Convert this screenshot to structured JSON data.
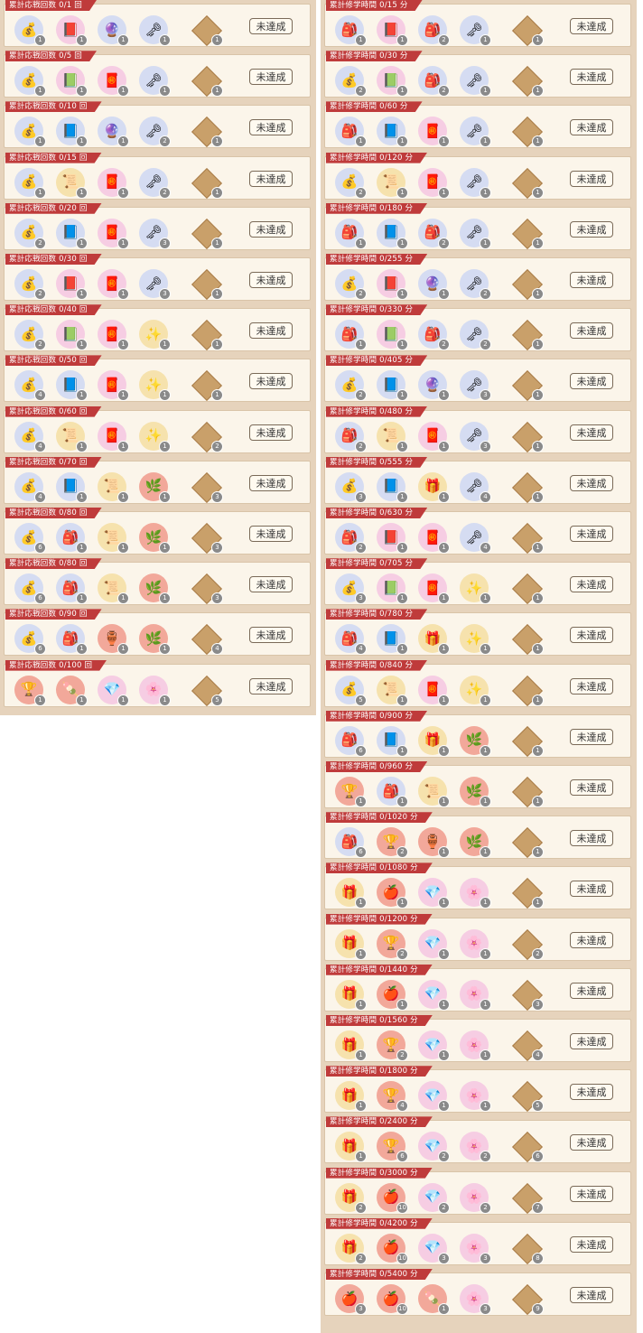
{
  "status_label": "未達成",
  "left_prefix": "累計応戦回数",
  "right_prefix": "累計修学時間",
  "icons": {
    "gold": {
      "glyph": "💰",
      "bg": "bg-bluel"
    },
    "book": {
      "glyph": "📕",
      "bg": "bg-pink"
    },
    "bluebook": {
      "glyph": "📘",
      "bg": "bg-bluel"
    },
    "greenbook": {
      "glyph": "📗",
      "bg": "bg-pink"
    },
    "scroll": {
      "glyph": "📜",
      "bg": "bg-gold"
    },
    "charm": {
      "glyph": "🧧",
      "bg": "bg-pink"
    },
    "talisman": {
      "glyph": "🔮",
      "bg": "bg-bluel"
    },
    "stick": {
      "glyph": "🗝",
      "bg": "bg-bluel"
    },
    "wand": {
      "glyph": "✨",
      "bg": "bg-gold"
    },
    "herb": {
      "glyph": "🌿",
      "bg": "bg-red"
    },
    "bag": {
      "glyph": "🎒",
      "bg": "bg-bluel"
    },
    "chest": {
      "glyph": "🎁",
      "bg": "bg-gold"
    },
    "ingot": {
      "glyph": "🏆",
      "bg": "bg-red"
    },
    "crystal": {
      "glyph": "💎",
      "bg": "bg-pink"
    },
    "petal": {
      "glyph": "🌸",
      "bg": "bg-pink"
    },
    "fruit": {
      "glyph": "🍎",
      "bg": "bg-red"
    },
    "dango": {
      "glyph": "🍡",
      "bg": "bg-red"
    },
    "bottle": {
      "glyph": "🏺",
      "bg": "bg-red"
    }
  },
  "left": [
    {
      "label": "累計応戦回数 0/1 回",
      "items": [
        [
          "gold",
          "1"
        ],
        [
          "book",
          "1"
        ],
        [
          "talisman",
          "1"
        ],
        [
          "stick",
          "1"
        ]
      ],
      "gem": "1"
    },
    {
      "label": "累計応戦回数 0/5 回",
      "items": [
        [
          "gold",
          "1"
        ],
        [
          "greenbook",
          "1"
        ],
        [
          "charm",
          "1"
        ],
        [
          "stick",
          "1"
        ]
      ],
      "gem": "1"
    },
    {
      "label": "累計応戦回数 0/10 回",
      "items": [
        [
          "gold",
          "1"
        ],
        [
          "bluebook",
          "1"
        ],
        [
          "talisman",
          "1"
        ],
        [
          "stick",
          "2"
        ]
      ],
      "gem": "1"
    },
    {
      "label": "累計応戦回数 0/15 回",
      "items": [
        [
          "gold",
          "1"
        ],
        [
          "scroll",
          "1"
        ],
        [
          "charm",
          "1"
        ],
        [
          "stick",
          "2"
        ]
      ],
      "gem": "1"
    },
    {
      "label": "累計応戦回数 0/20 回",
      "items": [
        [
          "gold",
          "2"
        ],
        [
          "bluebook",
          "1"
        ],
        [
          "charm",
          "1"
        ],
        [
          "stick",
          "3"
        ]
      ],
      "gem": "1"
    },
    {
      "label": "累計応戦回数 0/30 回",
      "items": [
        [
          "gold",
          "2"
        ],
        [
          "book",
          "1"
        ],
        [
          "charm",
          "1"
        ],
        [
          "stick",
          "3"
        ]
      ],
      "gem": "1"
    },
    {
      "label": "累計応戦回数 0/40 回",
      "items": [
        [
          "gold",
          "2"
        ],
        [
          "greenbook",
          "1"
        ],
        [
          "charm",
          "1"
        ],
        [
          "wand",
          "1"
        ]
      ],
      "gem": "1"
    },
    {
      "label": "累計応戦回数 0/50 回",
      "items": [
        [
          "gold",
          "4"
        ],
        [
          "bluebook",
          "1"
        ],
        [
          "charm",
          "1"
        ],
        [
          "wand",
          "1"
        ]
      ],
      "gem": "1"
    },
    {
      "label": "累計応戦回数 0/60 回",
      "items": [
        [
          "gold",
          "4"
        ],
        [
          "scroll",
          "1"
        ],
        [
          "charm",
          "1"
        ],
        [
          "wand",
          "1"
        ]
      ],
      "gem": "2"
    },
    {
      "label": "累計応戦回数 0/70 回",
      "items": [
        [
          "gold",
          "4"
        ],
        [
          "bluebook",
          "1"
        ],
        [
          "scroll",
          "1"
        ],
        [
          "herb",
          "1"
        ]
      ],
      "gem": "3"
    },
    {
      "label": "累計応戦回数 0/80 回",
      "items": [
        [
          "gold",
          "6"
        ],
        [
          "bag",
          "1"
        ],
        [
          "scroll",
          "1"
        ],
        [
          "herb",
          "1"
        ]
      ],
      "gem": "3"
    },
    {
      "label": "累計応戦回数 0/80 回",
      "items": [
        [
          "gold",
          "6"
        ],
        [
          "bag",
          "1"
        ],
        [
          "scroll",
          "1"
        ],
        [
          "herb",
          "1"
        ]
      ],
      "gem": "3"
    },
    {
      "label": "累計応戦回数 0/90 回",
      "items": [
        [
          "gold",
          "6"
        ],
        [
          "bag",
          "1"
        ],
        [
          "bottle",
          "1"
        ],
        [
          "herb",
          "1"
        ]
      ],
      "gem": "4"
    },
    {
      "label": "累計応戦回数 0/100 回",
      "items": [
        [
          "ingot",
          "1"
        ],
        [
          "dango",
          "1"
        ],
        [
          "crystal",
          "1"
        ],
        [
          "petal",
          "1"
        ]
      ],
      "gem": "5"
    }
  ],
  "right": [
    {
      "label": "累計修学時間 0/15 分",
      "items": [
        [
          "bag",
          "1"
        ],
        [
          "book",
          "1"
        ],
        [
          "bag",
          "2"
        ],
        [
          "stick",
          "1"
        ]
      ],
      "gem": "1"
    },
    {
      "label": "累計修学時間 0/30 分",
      "items": [
        [
          "gold",
          "2"
        ],
        [
          "greenbook",
          "1"
        ],
        [
          "bag",
          "2"
        ],
        [
          "stick",
          "1"
        ]
      ],
      "gem": "1"
    },
    {
      "label": "累計修学時間 0/60 分",
      "items": [
        [
          "bag",
          "1"
        ],
        [
          "bluebook",
          "1"
        ],
        [
          "charm",
          "1"
        ],
        [
          "stick",
          "1"
        ]
      ],
      "gem": "1"
    },
    {
      "label": "累計修学時間 0/120 分",
      "items": [
        [
          "gold",
          "2"
        ],
        [
          "scroll",
          "1"
        ],
        [
          "charm",
          "1"
        ],
        [
          "stick",
          "1"
        ]
      ],
      "gem": "1"
    },
    {
      "label": "累計修学時間 0/180 分",
      "items": [
        [
          "bag",
          "1"
        ],
        [
          "bluebook",
          "1"
        ],
        [
          "bag",
          "2"
        ],
        [
          "stick",
          "1"
        ]
      ],
      "gem": "1"
    },
    {
      "label": "累計修学時間 0/255 分",
      "items": [
        [
          "gold",
          "2"
        ],
        [
          "book",
          "1"
        ],
        [
          "talisman",
          "1"
        ],
        [
          "stick",
          "2"
        ]
      ],
      "gem": "1"
    },
    {
      "label": "累計修学時間 0/330 分",
      "items": [
        [
          "bag",
          "1"
        ],
        [
          "greenbook",
          "1"
        ],
        [
          "bag",
          "2"
        ],
        [
          "stick",
          "2"
        ]
      ],
      "gem": "1"
    },
    {
      "label": "累計修学時間 0/405 分",
      "items": [
        [
          "gold",
          "2"
        ],
        [
          "bluebook",
          "1"
        ],
        [
          "talisman",
          "1"
        ],
        [
          "stick",
          "3"
        ]
      ],
      "gem": "1"
    },
    {
      "label": "累計修学時間 0/480 分",
      "items": [
        [
          "bag",
          "2"
        ],
        [
          "scroll",
          "1"
        ],
        [
          "charm",
          "1"
        ],
        [
          "stick",
          "3"
        ]
      ],
      "gem": "1"
    },
    {
      "label": "累計修学時間 0/555 分",
      "items": [
        [
          "gold",
          "3"
        ],
        [
          "bluebook",
          "1"
        ],
        [
          "chest",
          "1"
        ],
        [
          "stick",
          "4"
        ]
      ],
      "gem": "1"
    },
    {
      "label": "累計修学時間 0/630 分",
      "items": [
        [
          "bag",
          "2"
        ],
        [
          "book",
          "1"
        ],
        [
          "charm",
          "1"
        ],
        [
          "stick",
          "4"
        ]
      ],
      "gem": "1"
    },
    {
      "label": "累計修学時間 0/705 分",
      "items": [
        [
          "gold",
          "3"
        ],
        [
          "greenbook",
          "1"
        ],
        [
          "charm",
          "1"
        ],
        [
          "wand",
          "1"
        ]
      ],
      "gem": "1"
    },
    {
      "label": "累計修学時間 0/780 分",
      "items": [
        [
          "bag",
          "4"
        ],
        [
          "bluebook",
          "1"
        ],
        [
          "chest",
          "1"
        ],
        [
          "wand",
          "1"
        ]
      ],
      "gem": "1"
    },
    {
      "label": "累計修学時間 0/840 分",
      "items": [
        [
          "gold",
          "5"
        ],
        [
          "scroll",
          "1"
        ],
        [
          "charm",
          "1"
        ],
        [
          "wand",
          "1"
        ]
      ],
      "gem": "1"
    },
    {
      "label": "累計修学時間 0/900 分",
      "items": [
        [
          "bag",
          "6"
        ],
        [
          "bluebook",
          "1"
        ],
        [
          "chest",
          "1"
        ],
        [
          "herb",
          "1"
        ]
      ],
      "gem": "1"
    },
    {
      "label": "累計修学時間 0/960 分",
      "items": [
        [
          "ingot",
          "1"
        ],
        [
          "bag",
          "1"
        ],
        [
          "scroll",
          "1"
        ],
        [
          "herb",
          "1"
        ]
      ],
      "gem": "1"
    },
    {
      "label": "累計修学時間 0/1020 分",
      "items": [
        [
          "bag",
          "6"
        ],
        [
          "ingot",
          "2"
        ],
        [
          "bottle",
          "1"
        ],
        [
          "herb",
          "1"
        ]
      ],
      "gem": "1"
    },
    {
      "label": "累計修学時間 0/1080 分",
      "items": [
        [
          "chest",
          "1"
        ],
        [
          "fruit",
          "1"
        ],
        [
          "crystal",
          "1"
        ],
        [
          "petal",
          "1"
        ]
      ],
      "gem": "1"
    },
    {
      "label": "累計修学時間 0/1200 分",
      "items": [
        [
          "chest",
          "1"
        ],
        [
          "ingot",
          "2"
        ],
        [
          "crystal",
          "1"
        ],
        [
          "petal",
          "1"
        ]
      ],
      "gem": "2"
    },
    {
      "label": "累計修学時間 0/1440 分",
      "items": [
        [
          "chest",
          "1"
        ],
        [
          "fruit",
          "1"
        ],
        [
          "crystal",
          "1"
        ],
        [
          "petal",
          "1"
        ]
      ],
      "gem": "3"
    },
    {
      "label": "累計修学時間 0/1560 分",
      "items": [
        [
          "chest",
          "1"
        ],
        [
          "ingot",
          "2"
        ],
        [
          "crystal",
          "1"
        ],
        [
          "petal",
          "1"
        ]
      ],
      "gem": "4"
    },
    {
      "label": "累計修学時間 0/1800 分",
      "items": [
        [
          "chest",
          "1"
        ],
        [
          "ingot",
          "4"
        ],
        [
          "crystal",
          "1"
        ],
        [
          "petal",
          "1"
        ]
      ],
      "gem": "5"
    },
    {
      "label": "累計修学時間 0/2400 分",
      "items": [
        [
          "chest",
          "1"
        ],
        [
          "ingot",
          "6"
        ],
        [
          "crystal",
          "2"
        ],
        [
          "petal",
          "2"
        ]
      ],
      "gem": "6"
    },
    {
      "label": "累計修学時間 0/3000 分",
      "items": [
        [
          "chest",
          "2"
        ],
        [
          "fruit",
          "10"
        ],
        [
          "crystal",
          "2"
        ],
        [
          "petal",
          "2"
        ]
      ],
      "gem": "7"
    },
    {
      "label": "累計修学時間 0/4200 分",
      "items": [
        [
          "chest",
          "2"
        ],
        [
          "fruit",
          "10"
        ],
        [
          "crystal",
          "3"
        ],
        [
          "petal",
          "3"
        ]
      ],
      "gem": "8"
    },
    {
      "label": "累計修学時間 0/5400 分",
      "items": [
        [
          "fruit",
          "3"
        ],
        [
          "fruit",
          "10"
        ],
        [
          "dango",
          "1"
        ],
        [
          "petal",
          "3"
        ]
      ],
      "gem": "9"
    }
  ]
}
